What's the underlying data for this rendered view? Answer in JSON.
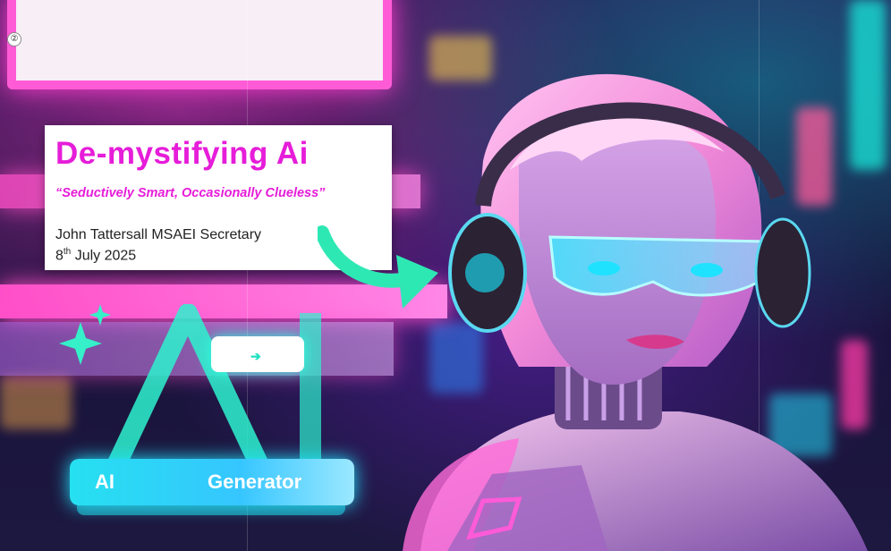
{
  "slide": {
    "title": "De-mystifying Ai",
    "subtitle": "“Seductively Smart, Occasionally Clueless”",
    "author": "John Tattersall MSAEI Secretary",
    "date_prefix": "8",
    "date_suffix": "th",
    "date_rest": " July 2025"
  },
  "ai_badge": {
    "left_label": "AI",
    "right_label": "Generator"
  },
  "colors": {
    "title_magenta": "#e61dd9",
    "neon_pink": "#ff4fc8",
    "neon_cyan": "#22e4ff",
    "arrow_teal": "#2ee8b4"
  },
  "icons": {
    "corner": "info-icon",
    "arrow": "curved-arrow-icon",
    "sparkles": "sparkle-icon"
  }
}
